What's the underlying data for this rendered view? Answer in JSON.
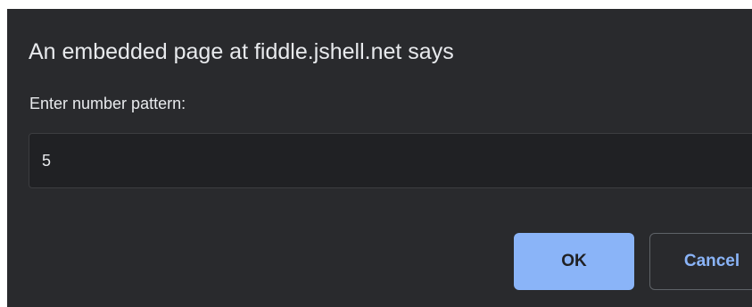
{
  "dialog": {
    "title": "An embedded page at fiddle.jshell.net says",
    "prompt_label": "Enter number pattern:",
    "input_value": "5",
    "ok_label": "OK",
    "cancel_label": "Cancel"
  },
  "colors": {
    "dialog_background": "#292a2d",
    "input_background": "#202124",
    "text": "#e8eaed",
    "accent": "#8ab4f8"
  }
}
